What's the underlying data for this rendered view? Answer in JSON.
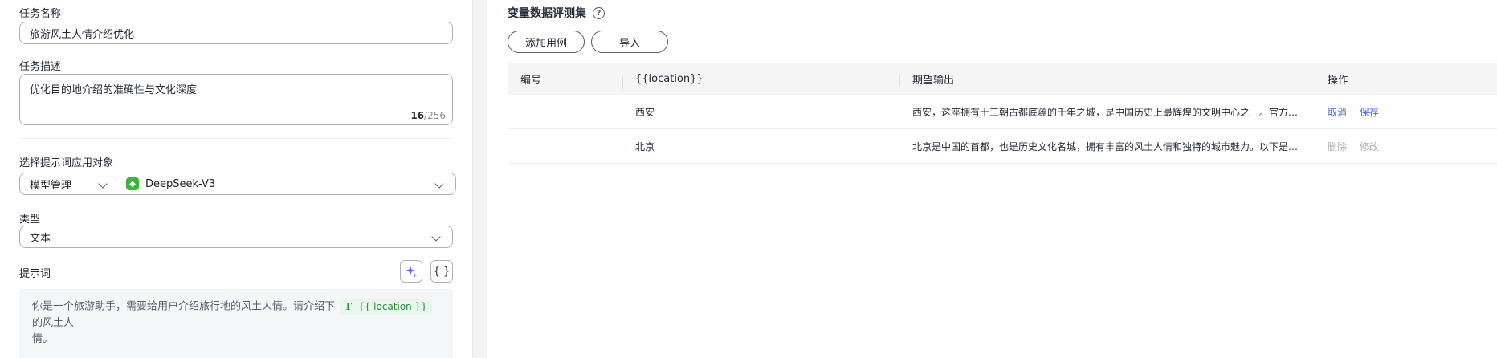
{
  "form": {
    "task_name_label": "任务名称",
    "task_name_value": "旅游风土人情介绍优化",
    "task_desc_label": "任务描述",
    "task_desc_value": "优化目的地介绍的准确性与文化深度",
    "task_desc_count": "16",
    "task_desc_max": "/256",
    "target_label": "选择提示词应用对象",
    "target_select_1": "模型管理",
    "target_select_2": "DeepSeek-V3",
    "type_label": "类型",
    "type_value": "文本",
    "prompt_label": "提示词",
    "prompt_text_before": "你是一个旅游助手，需要给用户介绍旅行地的风土人情。请介绍下",
    "prompt_var_icon": "T",
    "prompt_var": "{{ location }}",
    "prompt_text_after": "的风土人",
    "prompt_text_line2": "情。",
    "braces_label": "{ }"
  },
  "dataset": {
    "title": "变量数据评测集",
    "help_icon": "?",
    "add_button": "添加用例",
    "import_button": "导入",
    "columns": [
      "编号",
      "{{location}}",
      "期望输出",
      "操作"
    ],
    "rows": [
      {
        "id": "",
        "location": "西安",
        "expected": "西安，这座拥有十三朝古都底蕴的千年之城，是中国历史上最辉煌的文明中心之一。官方数据显示，西安拥有众多历史遗迹与文化名胜。",
        "action1": "取消",
        "action2": "保存"
      },
      {
        "id": "",
        "location": "北京",
        "expected": "北京是中国的首都，也是历史文化名城，拥有丰富的风土人情和独特的城市魅力。以下是关于北京风土人情的介绍。",
        "action1": "删除",
        "action2": "修改"
      }
    ]
  },
  "colors": {
    "accent_link": "#526ecc",
    "disabled": "#adb0b8",
    "var_tag_bg": "#e9f6ec",
    "model_icon": "#3fb33f"
  }
}
